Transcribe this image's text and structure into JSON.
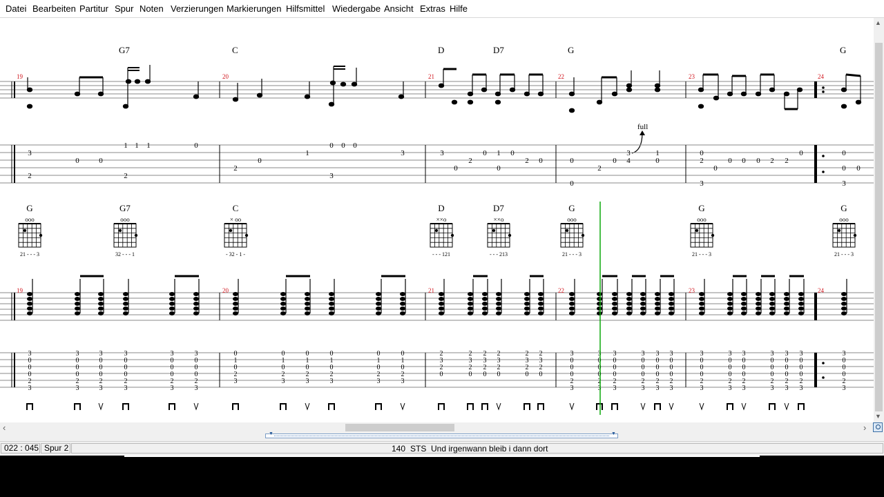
{
  "menu": [
    "Datei",
    "Bearbeiten",
    "Partitur",
    "Spur",
    "Noten",
    "Verzierungen",
    "Markierungen",
    "Hilfsmittel",
    "Wiedergabe",
    "Ansicht",
    "Extras",
    "Hilfe"
  ],
  "system1": {
    "chords": [
      {
        "label": "G7"
      },
      {
        "label": "C"
      },
      {
        "label": "D"
      },
      {
        "label": "D7"
      },
      {
        "label": "G"
      },
      {
        "label": "G"
      }
    ],
    "measure_numbers": [
      "19",
      "20",
      "21",
      "22",
      "23",
      "24"
    ],
    "bend_label": "full",
    "tab_fret": [
      "3",
      "0",
      "0",
      "2",
      "1",
      "1",
      "1",
      "2",
      "0",
      "2",
      "0",
      "1",
      "3",
      "0",
      "0",
      "0",
      "3",
      "3",
      "0",
      "2",
      "0",
      "0",
      "1",
      "0",
      "2",
      "0",
      "0",
      "2",
      "0",
      "0",
      "3",
      "0",
      "4",
      "1",
      "2",
      "0",
      "0",
      "0",
      "0",
      "0",
      "0",
      "2",
      "2",
      "0",
      "3",
      "0",
      "0",
      "3"
    ]
  },
  "system2": {
    "diagrams": [
      {
        "label": "G",
        "fingers": "21 - - - 3",
        "open": "ooo"
      },
      {
        "label": "G7",
        "fingers": "32 - - - 1",
        "open": "ooo"
      },
      {
        "label": "C",
        "fingers": "- 32 - 1 -",
        "open": "× oo"
      },
      {
        "label": "D",
        "fingers": "- - - 121",
        "open": "××o"
      },
      {
        "label": "D7",
        "fingers": "- - - 213",
        "open": "××o"
      },
      {
        "label": "G",
        "fingers": "21 - - - 3",
        "open": "ooo"
      },
      {
        "label": "G",
        "fingers": "21 - - - 3",
        "open": "ooo"
      },
      {
        "label": "G",
        "fingers": "21 - - - 3",
        "open": "ooo"
      }
    ],
    "measure_numbers": [
      "19",
      "20",
      "21",
      "22",
      "23",
      "24"
    ],
    "g_chord_col": [
      "3",
      "0",
      "0",
      "0",
      "2",
      "3"
    ],
    "c_chord_col": [
      "0",
      "1",
      "0",
      "2",
      "3",
      ""
    ],
    "d_chord_col": [
      "2",
      "3",
      "2",
      "0",
      "",
      ""
    ],
    "strums": [
      "down",
      "down",
      "up",
      "down",
      "down",
      "up",
      "down",
      "down",
      "up",
      "down",
      "down",
      "up",
      "down",
      "down",
      "down",
      "up",
      "down",
      "down",
      "up",
      "down",
      "down",
      "up",
      "down",
      "up",
      "up",
      "down",
      "up",
      "down",
      "up",
      "down"
    ]
  },
  "status": {
    "position": "022 : 045",
    "track": "Spur 2",
    "tempo": "140",
    "mode": "STS",
    "song": "Und irgenwann bleib i dann dort"
  },
  "colors": {
    "measure_number": "#d0141c",
    "cursor": "#0aa80a"
  }
}
